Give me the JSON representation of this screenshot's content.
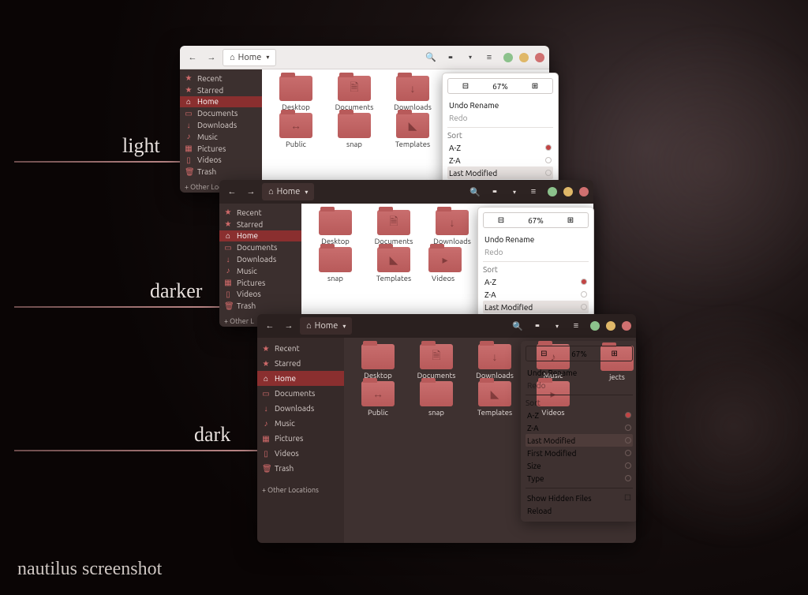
{
  "caption": "nautilus screenshot",
  "labels": {
    "light": "light",
    "darker": "darker",
    "dark": "dark"
  },
  "header": {
    "home": "Home",
    "back": "‹",
    "forward": "›",
    "search": "⌕",
    "view": "⠿",
    "drop": "▾",
    "menu": "≡"
  },
  "sidebar": {
    "items": [
      {
        "icon": "★",
        "label": "Recent"
      },
      {
        "icon": "★",
        "label": "Starred"
      },
      {
        "icon": "⌂",
        "label": "Home",
        "active": true
      },
      {
        "icon": "▭",
        "label": "Documents"
      },
      {
        "icon": "↓",
        "label": "Downloads"
      },
      {
        "icon": "♪",
        "label": "Music"
      },
      {
        "icon": "▦",
        "label": "Pictures"
      },
      {
        "icon": "▯",
        "label": "Videos"
      },
      {
        "icon": "🗑",
        "label": "Trash"
      }
    ],
    "other": "+  Other Locations",
    "other_short": "+  Other L"
  },
  "folders": [
    {
      "name": "Desktop",
      "glyph": ""
    },
    {
      "name": "Documents",
      "glyph": "🗎"
    },
    {
      "name": "Downloads",
      "glyph": "↓"
    },
    {
      "name": "Music",
      "glyph": "♪"
    },
    {
      "name": "Public",
      "glyph": "↔"
    },
    {
      "name": "snap",
      "glyph": ""
    },
    {
      "name": "Templates",
      "glyph": "◣"
    },
    {
      "name": "Videos",
      "glyph": "▸"
    }
  ],
  "clipped_folder": "jects",
  "pop": {
    "zoom_minus": "⊟",
    "zoom_val": "67%",
    "zoom_plus": "⊞",
    "undo": "Undo Rename",
    "redo": "Redo",
    "sort_label": "Sort",
    "sort": [
      "A-Z",
      "Z-A",
      "Last Modified",
      "First Modified",
      "Size",
      "Type"
    ],
    "hidden": "Show Hidden Files",
    "reload": "Reload"
  },
  "dots": [
    "#8cc28c",
    "#e0b868",
    "#d07070"
  ]
}
